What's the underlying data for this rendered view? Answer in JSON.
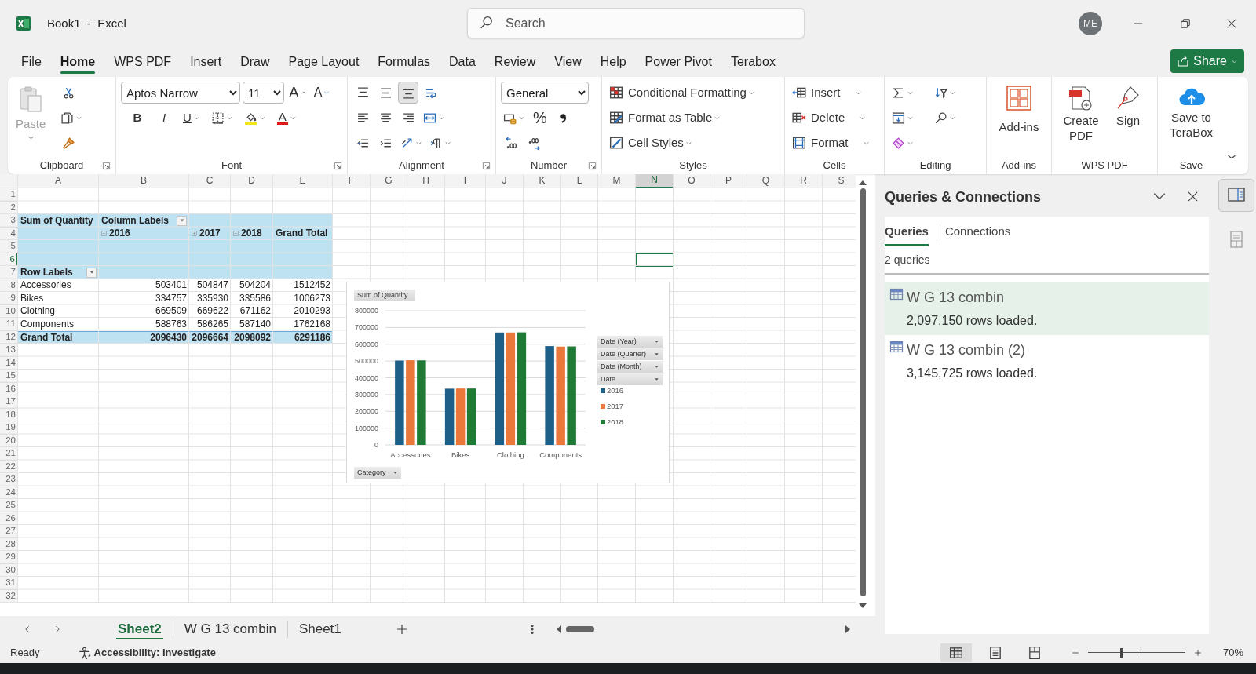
{
  "window": {
    "title": "Book1  -  Excel",
    "search_placeholder": "Search",
    "avatar": "ME"
  },
  "menu": [
    {
      "label": "File",
      "selected": false
    },
    {
      "label": "Home",
      "selected": true
    },
    {
      "label": "WPS PDF",
      "selected": false
    },
    {
      "label": "Insert",
      "selected": false
    },
    {
      "label": "Draw",
      "selected": false
    },
    {
      "label": "Page Layout",
      "selected": false
    },
    {
      "label": "Formulas",
      "selected": false
    },
    {
      "label": "Data",
      "selected": false
    },
    {
      "label": "Review",
      "selected": false
    },
    {
      "label": "View",
      "selected": false
    },
    {
      "label": "Help",
      "selected": false
    },
    {
      "label": "Power Pivot",
      "selected": false
    },
    {
      "label": "Terabox",
      "selected": false
    }
  ],
  "share": "Share",
  "ribbon": {
    "clipboard": {
      "paste": {
        "label": "Paste",
        "disabled": true
      },
      "label": "Clipboard"
    },
    "font": {
      "family": "Aptos Narrow",
      "size": "11",
      "grow": "A",
      "shrink": "A",
      "bold": "B",
      "italic": "I",
      "underline": "U",
      "color_button": "A",
      "label": "Font"
    },
    "alignment": {
      "vertical": [
        {
          "selected": false
        },
        {
          "selected": false
        },
        {
          "selected": true
        }
      ],
      "label": "Alignment"
    },
    "number": {
      "format": "General",
      "percent": "%",
      "label": "Number"
    },
    "styles": {
      "items": [
        "Conditional Formatting",
        "Format as Table",
        "Cell Styles"
      ],
      "label": "Styles"
    },
    "cells": {
      "items": [
        "Insert",
        "Delete",
        "Format"
      ],
      "label": "Cells"
    },
    "editing": {
      "label": "Editing"
    },
    "addins": {
      "button": "Add-ins",
      "label": "Add-ins"
    },
    "wps_pdf": {
      "buttons": [
        "Create PDF",
        "Sign"
      ],
      "label": "WPS PDF"
    },
    "save": {
      "button": "Save to TeraBox",
      "label": "Save"
    }
  },
  "sheet": {
    "columns": [
      {
        "label": "A",
        "selected": false
      },
      {
        "label": "B",
        "selected": false
      },
      {
        "label": "C",
        "selected": false
      },
      {
        "label": "D",
        "selected": false
      },
      {
        "label": "E",
        "selected": false
      },
      {
        "label": "F",
        "selected": false
      },
      {
        "label": "G",
        "selected": false
      },
      {
        "label": "H",
        "selected": false
      },
      {
        "label": "I",
        "selected": false
      },
      {
        "label": "J",
        "selected": false
      },
      {
        "label": "K",
        "selected": false
      },
      {
        "label": "L",
        "selected": false
      },
      {
        "label": "M",
        "selected": false
      },
      {
        "label": "N",
        "selected": true
      },
      {
        "label": "O",
        "selected": false
      },
      {
        "label": "P",
        "selected": false
      },
      {
        "label": "Q",
        "selected": false
      },
      {
        "label": "R",
        "selected": false
      },
      {
        "label": "S",
        "selected": false
      }
    ],
    "rows": [
      {
        "label": "1",
        "selected": false
      },
      {
        "label": "2",
        "selected": false
      },
      {
        "label": "3",
        "selected": false
      },
      {
        "label": "4",
        "selected": false
      },
      {
        "label": "5",
        "selected": false
      },
      {
        "label": "6",
        "selected": true
      },
      {
        "label": "7",
        "selected": false
      },
      {
        "label": "8",
        "selected": false
      },
      {
        "label": "9",
        "selected": false
      },
      {
        "label": "10",
        "selected": false
      },
      {
        "label": "11",
        "selected": false
      },
      {
        "label": "12",
        "selected": false
      },
      {
        "label": "13",
        "selected": false
      },
      {
        "label": "14",
        "selected": false
      },
      {
        "label": "15",
        "selected": false
      },
      {
        "label": "16",
        "selected": false
      },
      {
        "label": "17",
        "selected": false
      },
      {
        "label": "18",
        "selected": false
      },
      {
        "label": "19",
        "selected": false
      },
      {
        "label": "20",
        "selected": false
      },
      {
        "label": "21",
        "selected": false
      },
      {
        "label": "22",
        "selected": false
      },
      {
        "label": "23",
        "selected": false
      },
      {
        "label": "24",
        "selected": false
      },
      {
        "label": "25",
        "selected": false
      },
      {
        "label": "26",
        "selected": false
      },
      {
        "label": "27",
        "selected": false
      },
      {
        "label": "28",
        "selected": false
      },
      {
        "label": "29",
        "selected": false
      },
      {
        "label": "30",
        "selected": false
      },
      {
        "label": "31",
        "selected": false
      },
      {
        "label": "32",
        "selected": false
      }
    ]
  },
  "pivot": {
    "corner": "Sum of Quantity",
    "column_labels": "Column Labels",
    "years": [
      "2016",
      "2017",
      "2018"
    ],
    "grand_total_header": "Grand Total",
    "row_labels": "Row Labels",
    "rows": [
      {
        "label": "Accessories",
        "values": [
          "503401",
          "504847",
          "504204"
        ],
        "total": "1512452"
      },
      {
        "label": "Bikes",
        "values": [
          "334757",
          "335930",
          "335586"
        ],
        "total": "1006273"
      },
      {
        "label": "Clothing",
        "values": [
          "669509",
          "669622",
          "671162"
        ],
        "total": "2010293"
      },
      {
        "label": "Components",
        "values": [
          "588763",
          "586265",
          "587140"
        ],
        "total": "1762168"
      }
    ],
    "grand_total": {
      "label": "Grand Total",
      "values": [
        "2096430",
        "2096664",
        "2098092"
      ],
      "total": "6291186"
    }
  },
  "chart": {
    "value_button": "Sum of Quantity",
    "filter_buttons": [
      "Date (Year)",
      "Date (Quarter)",
      "Date (Month)",
      "Date"
    ],
    "axis_button": "Category",
    "chart_data": {
      "type": "bar",
      "categories": [
        "Accessories",
        "Bikes",
        "Clothing",
        "Components"
      ],
      "series": [
        {
          "name": "2016",
          "color": "#1d5f86",
          "values": [
            503000,
            335000,
            670000,
            589000
          ]
        },
        {
          "name": "2017",
          "color": "#e9783a",
          "values": [
            505000,
            336000,
            670000,
            586000
          ]
        },
        {
          "name": "2018",
          "color": "#1f7a36",
          "values": [
            504000,
            336000,
            671000,
            587000
          ]
        }
      ],
      "grid": true,
      "legend": true,
      "ylim": [
        0,
        800000
      ],
      "yticks": [
        0,
        100000,
        200000,
        300000,
        400000,
        500000,
        600000,
        700000,
        800000
      ]
    }
  },
  "sheet_tabs": [
    {
      "label": "Sheet2",
      "selected": true
    },
    {
      "label": "W G 13 combin",
      "selected": false
    },
    {
      "label": "Sheet1",
      "selected": false
    }
  ],
  "panel": {
    "title": "Queries & Connections",
    "tabs": [
      {
        "label": "Queries",
        "selected": true
      },
      {
        "label": "Connections",
        "selected": false
      }
    ],
    "count": "2 queries",
    "queries": [
      {
        "name": "W G 13 combin",
        "status": "2,097,150 rows loaded.",
        "selected": true
      },
      {
        "name": "W G 13 combin (2)",
        "status": "3,145,725 rows loaded.",
        "selected": false
      }
    ]
  },
  "rail": [
    {
      "selected": true
    },
    {
      "selected": false
    }
  ],
  "status_bar": {
    "ready": "Ready",
    "accessibility": "Accessibility: Investigate",
    "views": [
      {
        "selected": true
      },
      {
        "selected": false
      },
      {
        "selected": false
      }
    ],
    "zoom_slider": {
      "level": 0.35
    },
    "zoom": "70%"
  }
}
